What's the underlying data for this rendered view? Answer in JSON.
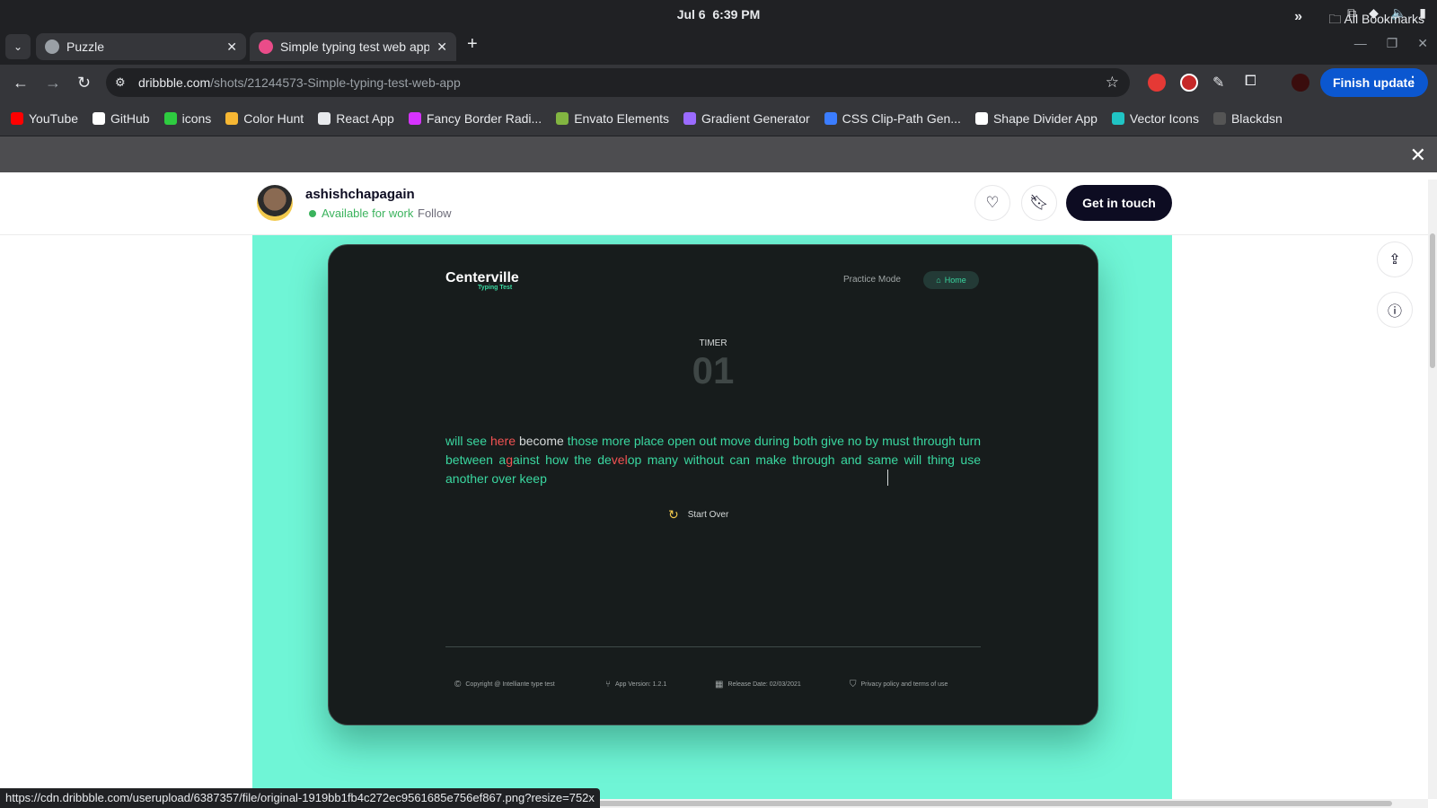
{
  "os": {
    "date": "Jul 6",
    "time": "6:39 PM"
  },
  "tabs": [
    {
      "label": "Puzzle"
    },
    {
      "label": "Simple typing test web app"
    }
  ],
  "omnibox": {
    "host": "dribbble.com",
    "path": "/shots/21244573-Simple-typing-test-web-app"
  },
  "finish_update": "Finish update",
  "bookmarks": [
    {
      "label": "YouTube",
      "color": "#ff0000"
    },
    {
      "label": "GitHub",
      "color": "#ffffff"
    },
    {
      "label": "icons",
      "color": "#2ecc40"
    },
    {
      "label": "Color Hunt",
      "color": "#f7b733"
    },
    {
      "label": "React App",
      "color": "#e8eaed"
    },
    {
      "label": "Fancy Border Radi...",
      "color": "#d633ff"
    },
    {
      "label": "Envato Elements",
      "color": "#82b541"
    },
    {
      "label": "Gradient Generator",
      "color": "#9b6bff"
    },
    {
      "label": "CSS Clip-Path Gen...",
      "color": "#3b7dff"
    },
    {
      "label": "Shape Divider App",
      "color": "#ffffff"
    },
    {
      "label": "Vector Icons",
      "color": "#20c4c4"
    },
    {
      "label": "Blackdsn",
      "color": "#555555"
    }
  ],
  "all_bookmarks": "All Bookmarks",
  "shot": {
    "author": "ashishchapagain",
    "availability": "Available for work",
    "follow": "Follow",
    "get_in_touch": "Get in touch"
  },
  "app": {
    "brand": "Centerville",
    "brand_sub": "Typing Test",
    "nav_practice": "Practice Mode",
    "nav_home": "Home",
    "timer_label": "TIMER",
    "timer_value": "01",
    "start_over": "Start Over",
    "footer": {
      "copyright": "Copyright @ Intelliante type test",
      "version": "App Version: 1.2.1",
      "release": "Release Date: 02/03/2021",
      "privacy": "Privacy policy and terms of use"
    }
  },
  "status_url": "https://cdn.dribbble.com/userupload/6387357/file/original-1919bb1fb4c272ec9561685e756ef867.png?resize=752x",
  "colors": {
    "accent": "#3ad7a0",
    "error": "#f05252",
    "shot_bg": "#6ff5d6",
    "device_bg": "#171c1c",
    "dribbble_dark": "#0d0c22"
  }
}
